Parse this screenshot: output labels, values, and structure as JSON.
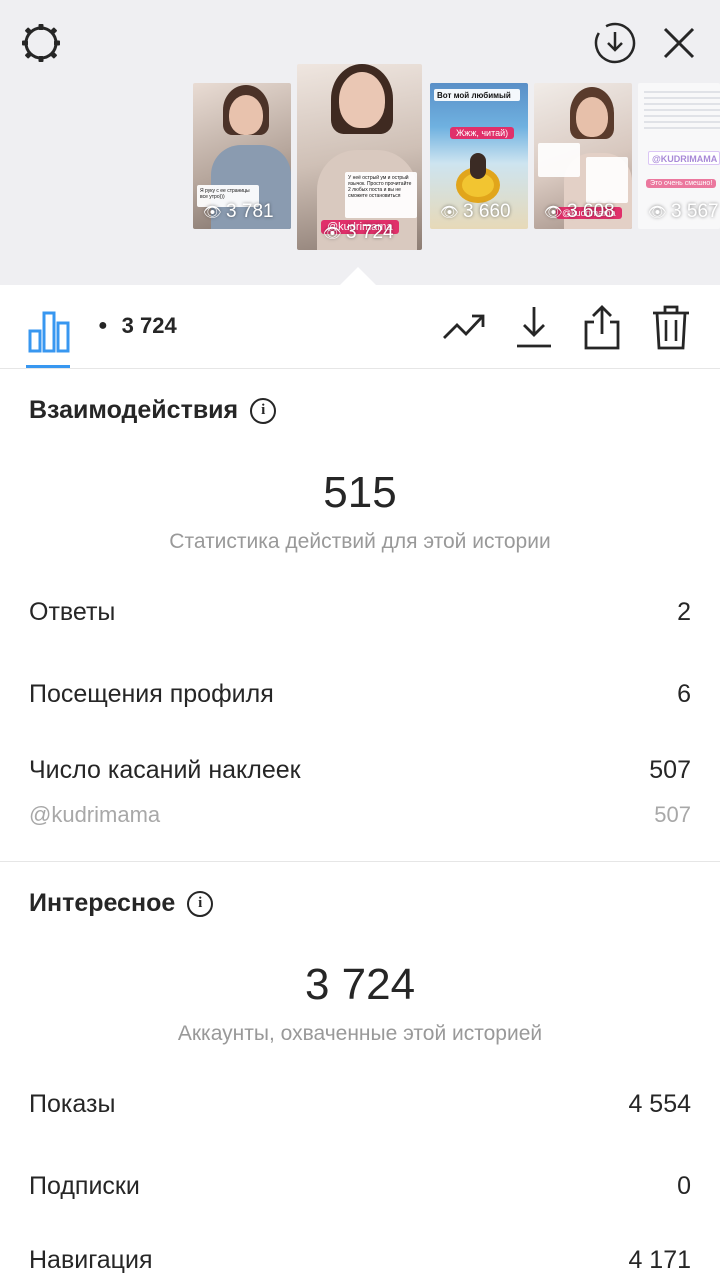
{
  "top_bar": {
    "settings_icon": "settings-gear-icon",
    "download_icon": "download-circle-icon",
    "close_icon": "close-icon"
  },
  "stories": [
    {
      "views": "3 781",
      "caption": "Я руку с ее страницы все утро)))"
    },
    {
      "views": "3 724",
      "caption": "У неё острый ум и острый язычок. Просто прочитайте 2 любых поста и вы не сможете остановиться",
      "tag": "@kudrimama"
    },
    {
      "views": "3 660",
      "caption": "Вот мой любимый",
      "tag": "Жжж, читай)"
    },
    {
      "views": "3 608",
      "caption": "",
      "tag": "@kudrimama"
    },
    {
      "views": "3 567",
      "caption": "@KUDRIMAMA",
      "tag": "Это очень смешно!"
    }
  ],
  "toolbar": {
    "views": "3 724",
    "insights_icon": "bar-chart-icon",
    "promote_icon": "trending-up-icon",
    "save_icon": "download-icon",
    "share_icon": "share-icon",
    "delete_icon": "trash-icon"
  },
  "interactions": {
    "title": "Взаимодействия",
    "total": "515",
    "caption": "Статистика действий для этой истории",
    "rows": [
      {
        "label": "Ответы",
        "value": "2"
      },
      {
        "label": "Посещения профиля",
        "value": "6"
      },
      {
        "label": "Число касаний наклеек",
        "value": "507"
      }
    ],
    "sticker": {
      "label": "@kudrimama",
      "value": "507"
    }
  },
  "discovery": {
    "title": "Интересное",
    "total": "3 724",
    "caption": "Аккаунты, охваченные этой историей",
    "rows": [
      {
        "label": "Показы",
        "value": "4 554"
      },
      {
        "label": "Подписки",
        "value": "0"
      },
      {
        "label": "Навигация",
        "value": "4 171"
      }
    ]
  },
  "colors": {
    "accent": "#3897f0",
    "top_background": "#efeff2",
    "secondary_text": "#999999"
  }
}
